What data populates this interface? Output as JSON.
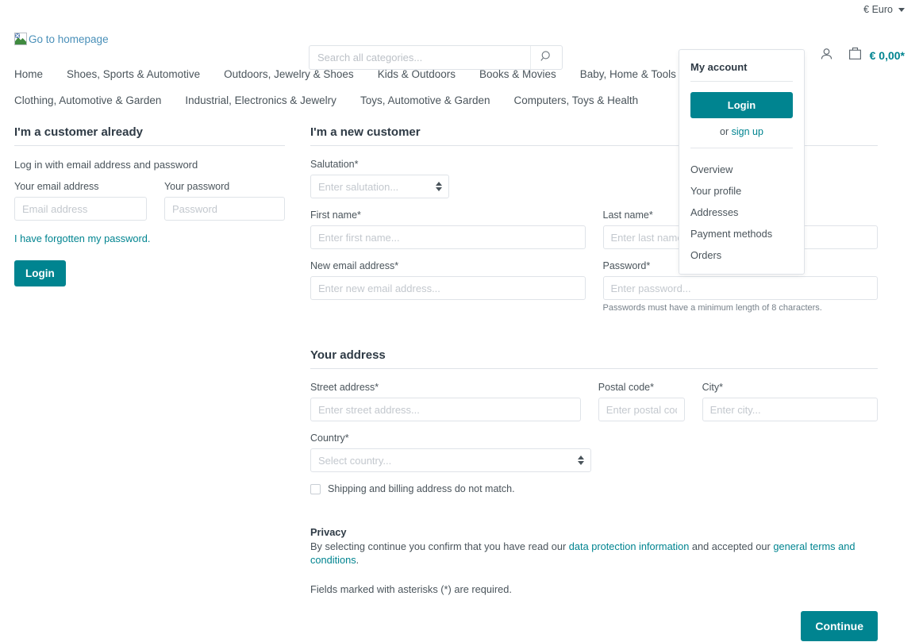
{
  "topbar": {
    "currency_label": "€ Euro"
  },
  "header": {
    "logo_alt": "Go to homepage",
    "search_placeholder": "Search all categories...",
    "search_value": "",
    "cart_amount": "€ 0,00*",
    "accent_color": "#008490"
  },
  "nav": {
    "items": [
      {
        "label": "Home"
      },
      {
        "label": "Shoes, Sports & Automotive"
      },
      {
        "label": "Outdoors, Jewelry & Shoes"
      },
      {
        "label": "Kids & Outdoors"
      },
      {
        "label": "Books & Movies"
      },
      {
        "label": "Baby, Home & Tools"
      },
      {
        "label": "Clothing, Automotive & Garden"
      },
      {
        "label": "Industrial, Electronics & Jewelry"
      },
      {
        "label": "Toys, Automotive & Garden"
      },
      {
        "label": "Computers, Toys & Health"
      }
    ]
  },
  "account_dropdown": {
    "title": "My account",
    "login_label": "Login",
    "or_text": "or",
    "signup_label": "sign up",
    "items": [
      {
        "label": "Overview"
      },
      {
        "label": "Your profile"
      },
      {
        "label": "Addresses"
      },
      {
        "label": "Payment methods"
      },
      {
        "label": "Orders"
      }
    ]
  },
  "existing_customer": {
    "title": "I'm a customer already",
    "helper": "Log in with email address and password",
    "email_label": "Your email address",
    "email_placeholder": "Email address",
    "email_value": "",
    "password_label": "Your password",
    "password_placeholder": "Password",
    "password_value": "",
    "forgot_link": "I have forgotten my password.",
    "login_label": "Login"
  },
  "new_customer": {
    "title": "I'm a new customer",
    "salutation_label": "Salutation*",
    "salutation_placeholder": "Enter salutation...",
    "first_name_label": "First name*",
    "first_name_placeholder": "Enter first name...",
    "first_name_value": "",
    "last_name_label": "Last name*",
    "last_name_placeholder": "Enter last name...",
    "last_name_value": "",
    "new_email_label": "New email address*",
    "new_email_placeholder": "Enter new email address...",
    "new_email_value": "",
    "password_label": "Password*",
    "password_placeholder": "Enter password...",
    "password_value": "",
    "password_hint": "Passwords must have a minimum length of 8 characters."
  },
  "address": {
    "title": "Your address",
    "street_label": "Street address*",
    "street_placeholder": "Enter street address...",
    "street_value": "",
    "postal_label": "Postal code*",
    "postal_placeholder": "Enter postal code...",
    "postal_value": "",
    "city_label": "City*",
    "city_placeholder": "Enter city...",
    "city_value": "",
    "country_label": "Country*",
    "country_placeholder": "Select country...",
    "different_shipping_label": "Shipping and billing address do not match.",
    "different_shipping_checked": false
  },
  "privacy": {
    "title": "Privacy",
    "text_before": "By selecting continue you confirm that you have read our ",
    "link_data_protection": "data protection information",
    "text_middle": " and accepted our ",
    "link_terms": "general terms and conditions",
    "text_after": ".",
    "required_note": "Fields marked with asterisks (*) are required.",
    "continue_label": "Continue"
  }
}
